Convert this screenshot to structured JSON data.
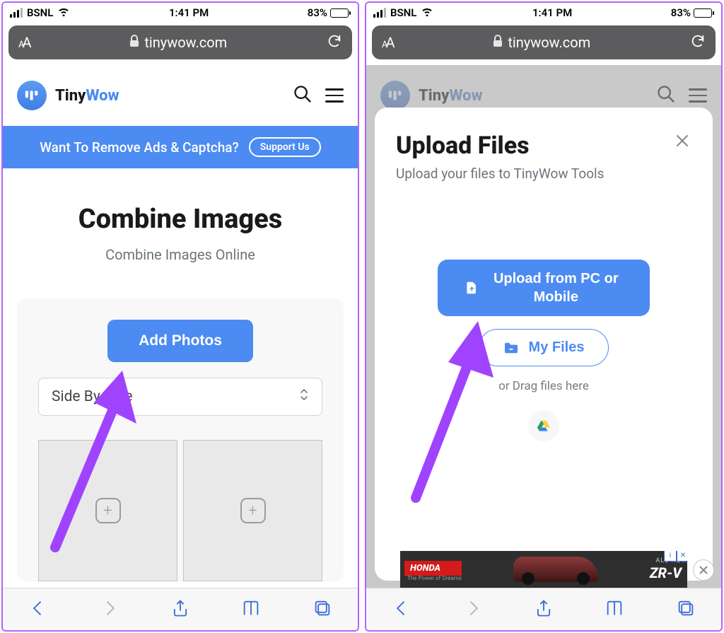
{
  "status_bar": {
    "carrier": "BSNL",
    "time": "1:41 PM",
    "battery_pct": "83%"
  },
  "safari": {
    "aa_small": "A",
    "aa_large": "A",
    "domain": "tinywow.com"
  },
  "header": {
    "brand_tiny": "Tiny",
    "brand_wow": "Wow"
  },
  "ad_banner": {
    "text": "Want To Remove Ads & Captcha?",
    "cta": "Support Us"
  },
  "page": {
    "title": "Combine Images",
    "subtitle": "Combine Images Online",
    "add_photos": "Add Photos",
    "layout_select": "Side By Side"
  },
  "modal": {
    "title": "Upload Files",
    "subtitle": "Upload your files to TinyWow Tools",
    "upload_btn": "Upload from PC or Mobile",
    "myfiles_btn": "My Files",
    "drag_text": "or Drag files here"
  },
  "bottom_ad": {
    "brand": "HONDA",
    "tagline": "The Power of Dreams",
    "allnew": "ALL-NEW",
    "model": "ZR-V"
  }
}
